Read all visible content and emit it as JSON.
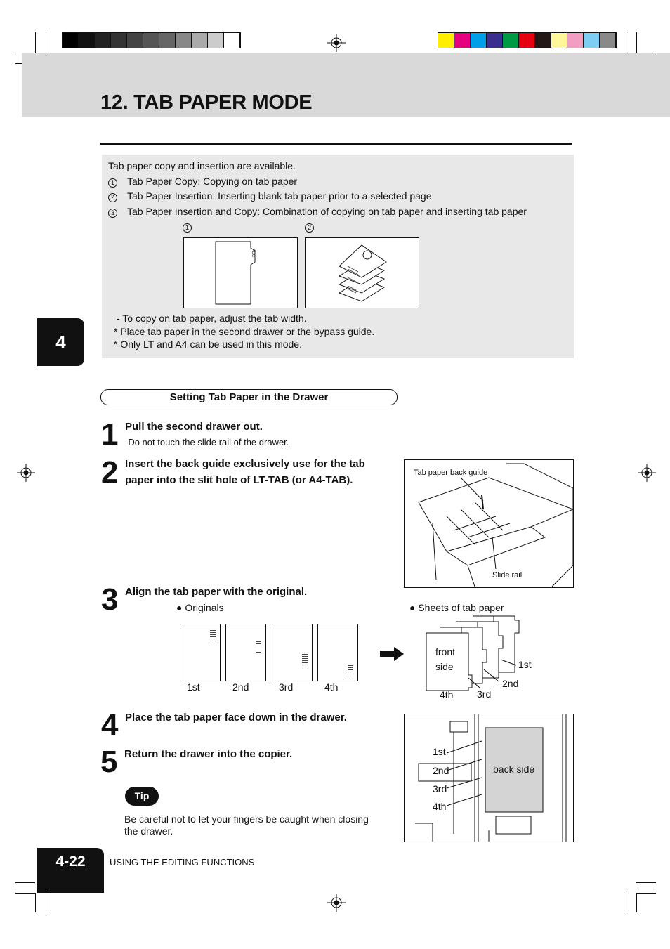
{
  "registration": {
    "grayscale": [
      "#000000",
      "#111111",
      "#222222",
      "#333333",
      "#444444",
      "#555555",
      "#666666",
      "#888888",
      "#aaaaaa",
      "#cccccc",
      "#ffffff"
    ],
    "colors": [
      "#ffee00",
      "#e6007e",
      "#00a0e9",
      "#3a2f8f",
      "#009944",
      "#e60012",
      "#231815",
      "#fff799",
      "#f19ec2",
      "#7ecef4",
      "#898989"
    ]
  },
  "header": {
    "title": "12. TAB PAPER MODE"
  },
  "intro": {
    "lead": "Tab paper copy and insertion are available.",
    "items": [
      {
        "num": "1",
        "text": "Tab Paper Copy:  Copying on tab paper"
      },
      {
        "num": "2",
        "text": "Tab Paper Insertion:  Inserting blank tab paper prior to a selected page"
      },
      {
        "num": "3",
        "text": "Tab Paper Insertion and Copy:  Combination of copying on tab paper and inserting tab paper"
      }
    ],
    "figure_labels": [
      "1",
      "2"
    ],
    "tab_text": "ABC",
    "notes": [
      "- To copy on tab paper, adjust the tab width.",
      "*  Place tab paper in the second drawer or the bypass guide.",
      "*  Only LT and A4 can be used in this mode."
    ]
  },
  "chapter_tab": "4",
  "section": {
    "title": "Setting Tab Paper in the Drawer"
  },
  "steps": [
    {
      "num": "1",
      "title": "Pull the second drawer out.",
      "sub": "-Do not touch the slide rail of the drawer."
    },
    {
      "num": "2",
      "title_line1": "Insert  the  back  guide  exclusively  use  for  the  tab",
      "title_line2": "paper into the slit hole of LT-TAB (or A4-TAB)."
    },
    {
      "num": "3",
      "title": "Align the tab paper with the original."
    },
    {
      "num": "4",
      "title": "Place the tab paper face down in the drawer."
    },
    {
      "num": "5",
      "title": "Return the drawer into the copier."
    }
  ],
  "drawer_figure": {
    "guide_label": "Tab paper back guide",
    "rail_label": "Slide rail"
  },
  "originals": {
    "heading": "● Originals",
    "labels": [
      "1st",
      "2nd",
      "3rd",
      "4th"
    ]
  },
  "sheets": {
    "heading": "● Sheets of tab paper",
    "front": "front",
    "side": "side",
    "labels": [
      "1st",
      "2nd",
      "3rd",
      "4th"
    ]
  },
  "tray": {
    "back_side": "back side",
    "labels": [
      "1st",
      "2nd",
      "3rd",
      "4th"
    ]
  },
  "tip": {
    "badge": "Tip",
    "line1": "Be careful not to let your fingers be caught when closing",
    "line2": "the drawer."
  },
  "footer": {
    "page": "4-22",
    "section": "USING THE EDITING FUNCTIONS"
  }
}
